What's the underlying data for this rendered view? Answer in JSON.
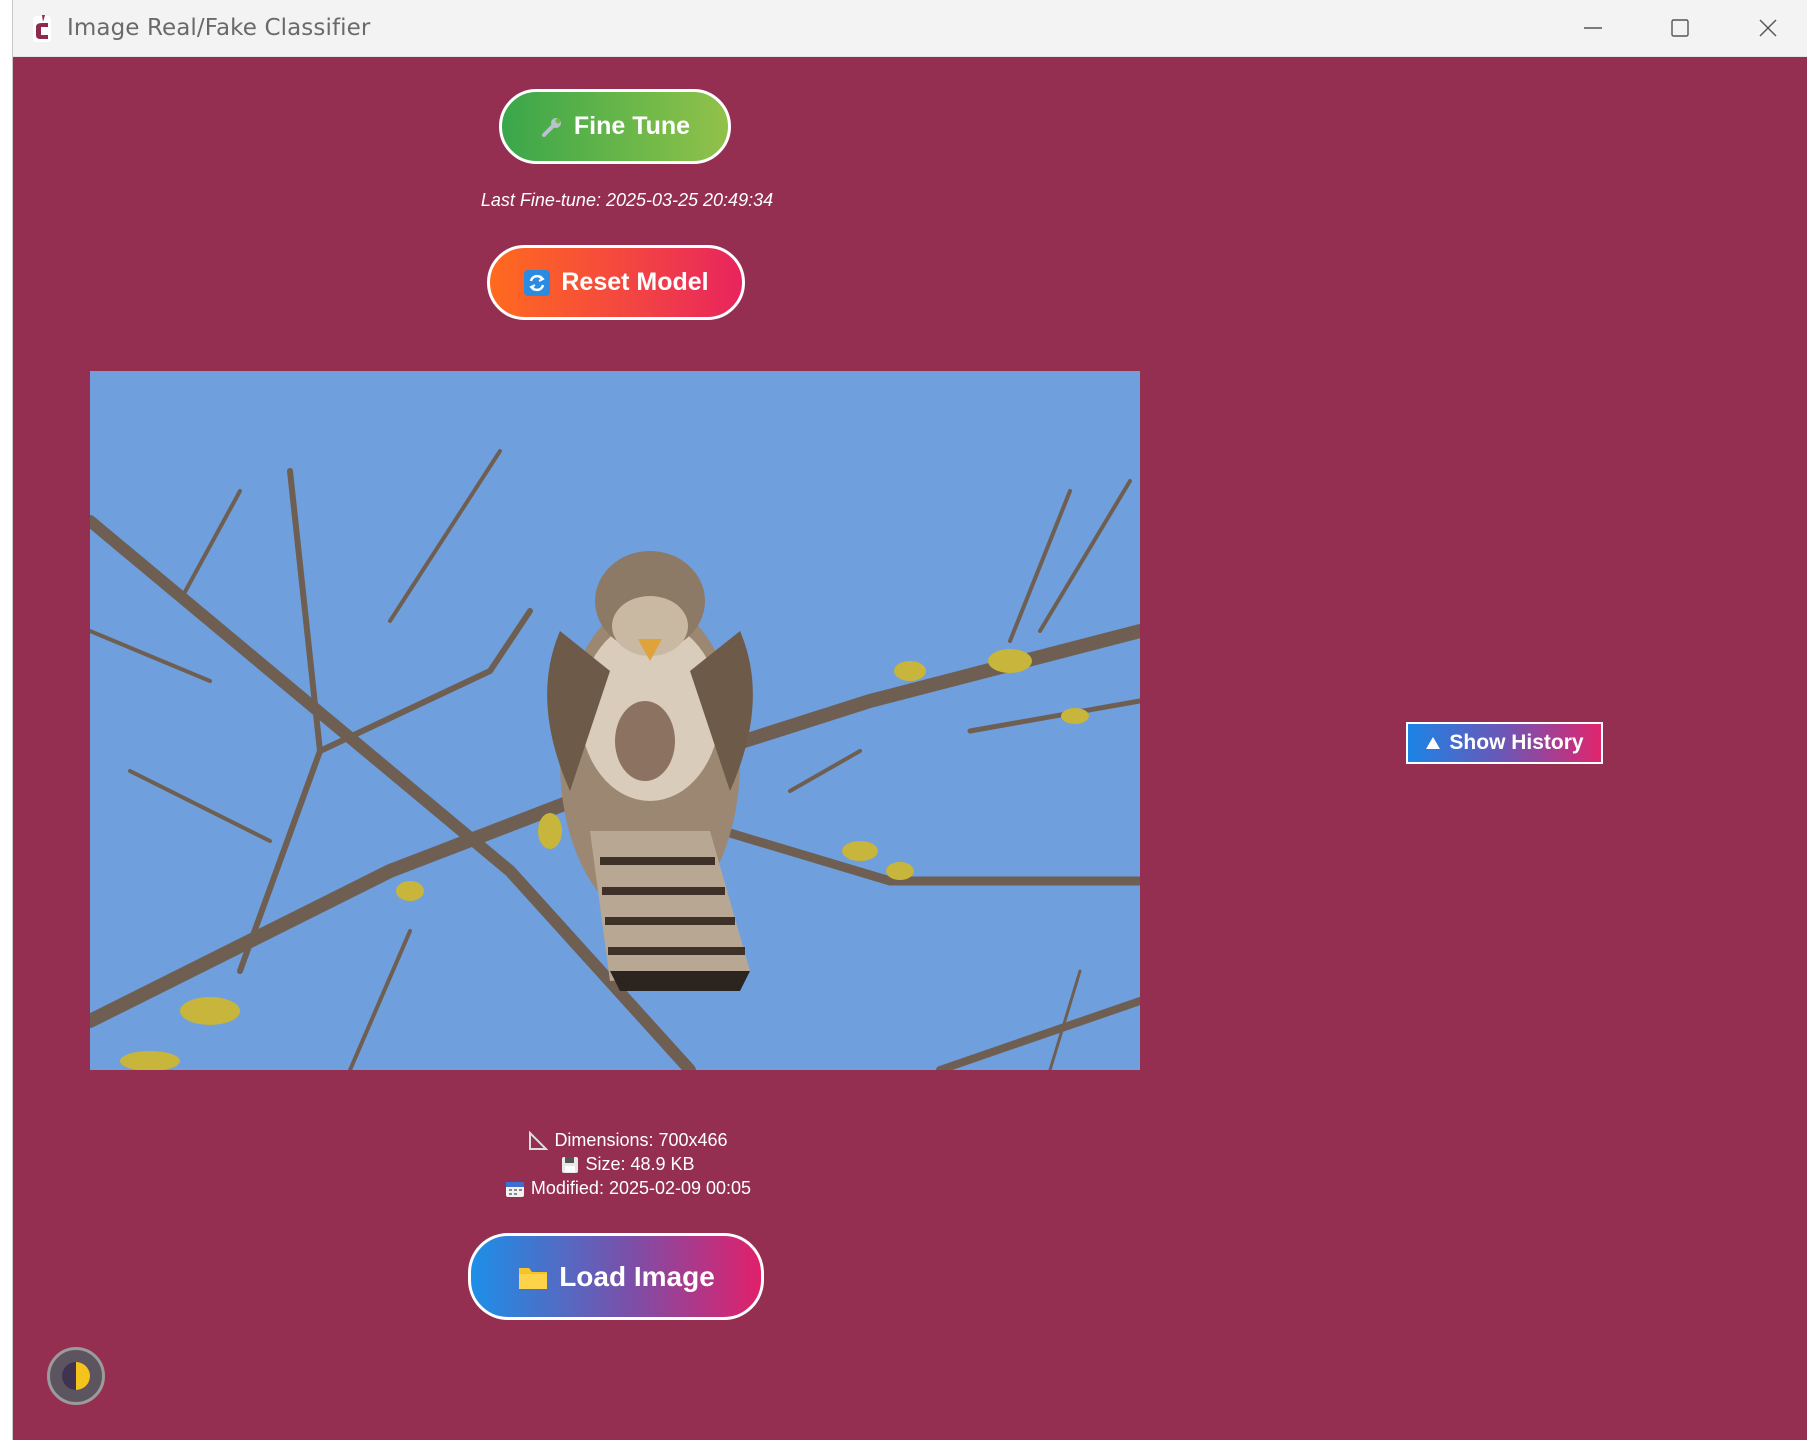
{
  "window": {
    "title": "Image Real/Fake Classifier"
  },
  "actions": {
    "fine_tune_label": "Fine Tune",
    "last_fine_tune": "Last Fine-tune: 2025-03-25 20:49:34",
    "reset_label": "Reset Model",
    "load_label": "Load Image",
    "history_label": "Show History"
  },
  "image_info": {
    "dimensions": "Dimensions: 700x466",
    "size": "Size: 48.9 KB",
    "modified": "Modified: 2025-02-09 00:05"
  },
  "preview": {
    "subject": "Kestrel perched on a bare branch against blue sky"
  },
  "icons": {
    "app": "app-logo-icon",
    "fine_tune": "wrench-icon",
    "reset": "refresh-icon",
    "load": "folder-icon",
    "history": "triangle-up-icon",
    "dimensions": "ruler-icon",
    "size": "floppy-disk-icon",
    "modified": "calendar-icon",
    "theme": "half-moon-icon"
  },
  "colors": {
    "background": "#942f52",
    "sky": "#6f9fdc",
    "titlebar": "#f3f3f3"
  }
}
